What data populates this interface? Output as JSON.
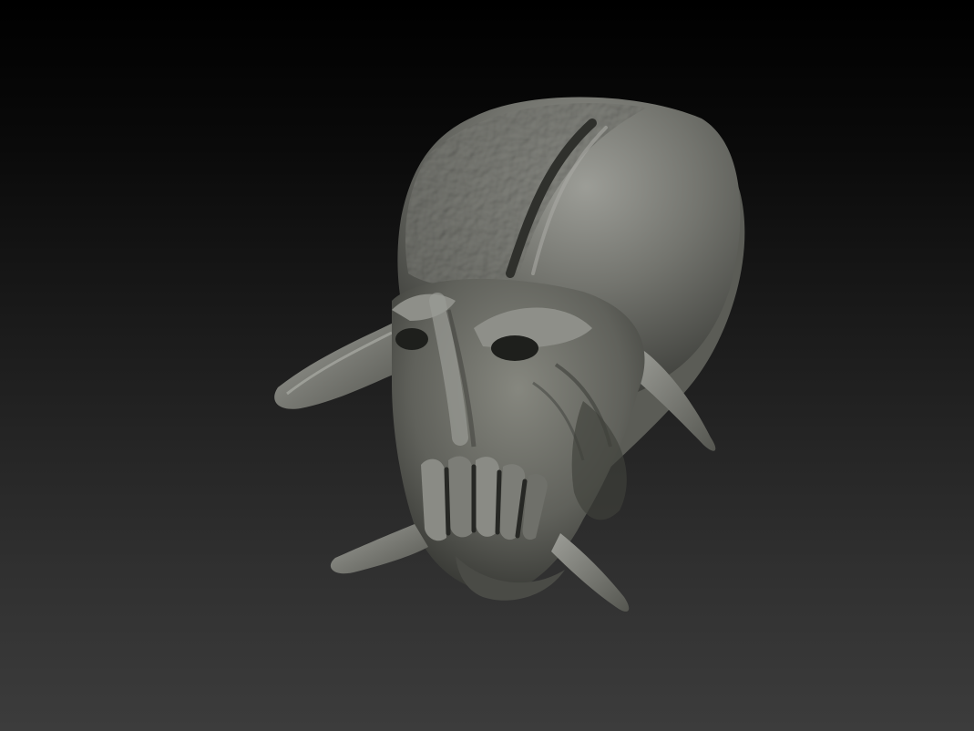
{
  "scene": {
    "subject": "sculpted-creature-head",
    "colors": {
      "background_top": "#000000",
      "background_bottom": "#3c3c3c",
      "clay_base": "#6a6b66",
      "clay_highlight": "#a3a49e",
      "clay_shadow": "#2b2c29"
    }
  }
}
